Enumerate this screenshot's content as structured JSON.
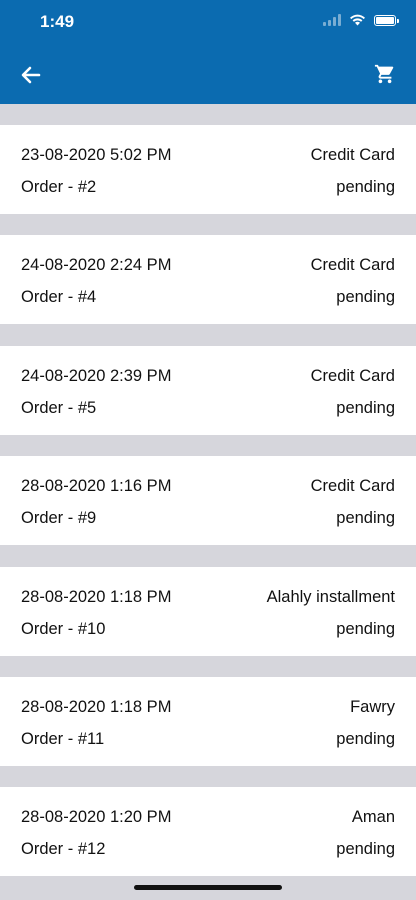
{
  "status_bar": {
    "time": "1:49"
  },
  "header": {
    "back_icon": "arrow-left-icon",
    "cart_icon": "cart-icon",
    "background_color": "#0b6bb0"
  },
  "orders": [
    {
      "date": "23-08-2020 5:02 PM",
      "payment": "Credit Card",
      "order": "Order - #2",
      "status": "pending"
    },
    {
      "date": "24-08-2020 2:24 PM",
      "payment": "Credit Card",
      "order": "Order - #4",
      "status": "pending"
    },
    {
      "date": "24-08-2020 2:39 PM",
      "payment": "Credit Card",
      "order": "Order - #5",
      "status": "pending"
    },
    {
      "date": "28-08-2020 1:16 PM",
      "payment": "Credit Card",
      "order": "Order - #9",
      "status": "pending"
    },
    {
      "date": "28-08-2020 1:18 PM",
      "payment": "Alahly installment",
      "order": "Order - #10",
      "status": "pending"
    },
    {
      "date": "28-08-2020 1:18 PM",
      "payment": "Fawry",
      "order": "Order - #11",
      "status": "pending"
    },
    {
      "date": "28-08-2020 1:20 PM",
      "payment": "Aman",
      "order": "Order - #12",
      "status": "pending"
    }
  ]
}
